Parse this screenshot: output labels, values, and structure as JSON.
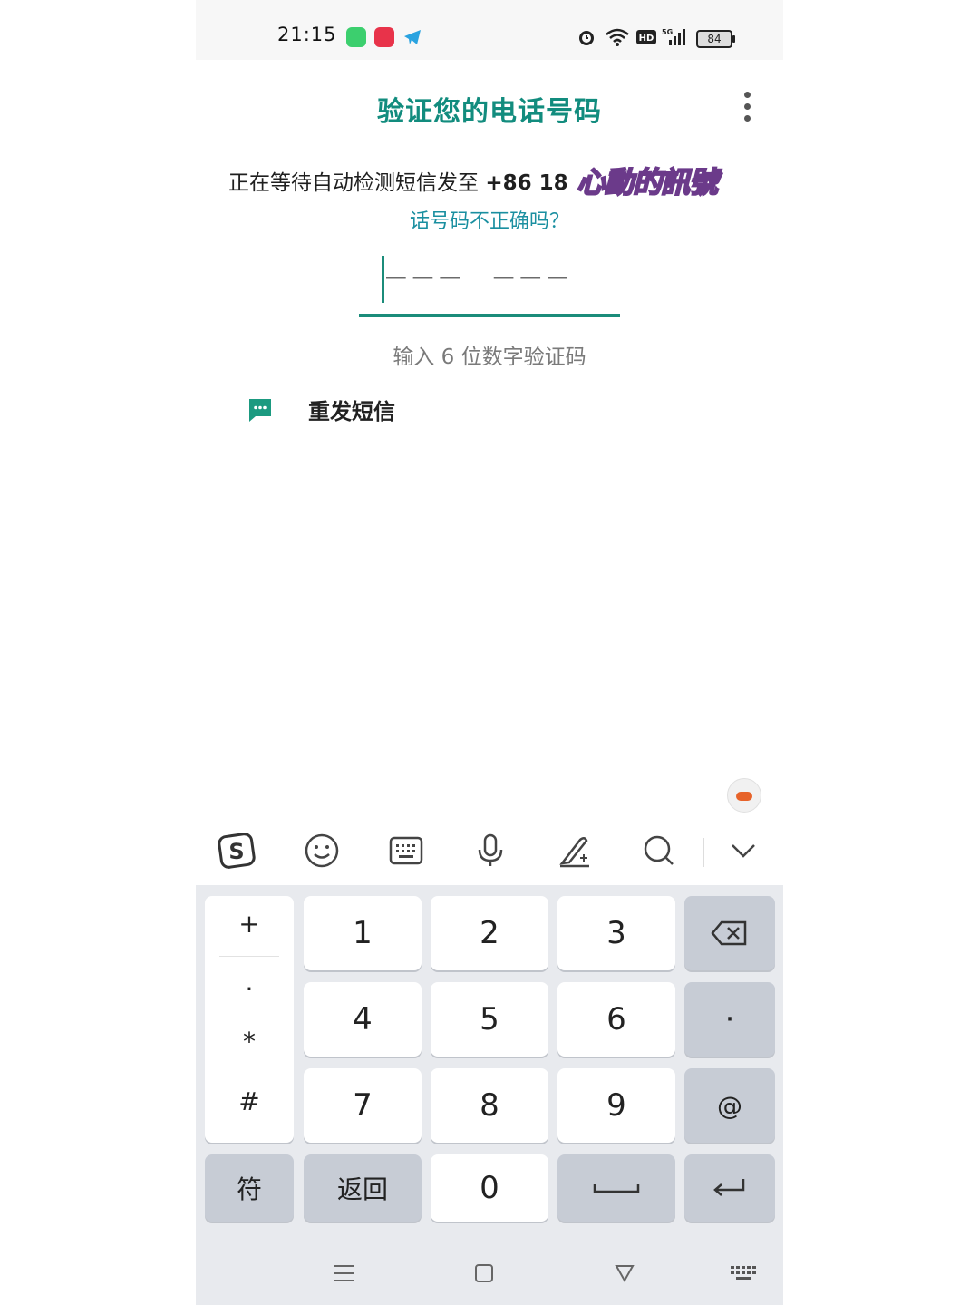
{
  "status_bar": {
    "time": "21:15",
    "apps": [
      "green-app-icon",
      "red-app-icon",
      "telegram-icon"
    ],
    "indicators": [
      "alarm-icon",
      "wifi-icon",
      "hd-icon",
      "5g-signal-icon"
    ],
    "battery": "84"
  },
  "header": {
    "title": "验证您的电话号码",
    "menu_icon": "more-vert-icon"
  },
  "body": {
    "waiting_text": "正在等待自动检测短信发至 ",
    "phone_prefix": "+86 18",
    "overlay_sticker": "心動的訊號",
    "wrong_number_link": "话号码不正确吗？",
    "code_placeholder": "––– –––",
    "code_hint": "输入 6 位数字验证码",
    "resend_label": "重发短信"
  },
  "keyboard": {
    "toolbar": [
      "sogou-logo-icon",
      "emoji-icon",
      "keyboard-icon",
      "microphone-icon",
      "handwriting-icon",
      "search-icon",
      "collapse-chevron-icon"
    ],
    "symbols": [
      "+",
      ".",
      "*",
      "#"
    ],
    "digits": [
      "1",
      "2",
      "3",
      "4",
      "5",
      "6",
      "7",
      "8",
      "9",
      "0"
    ],
    "right_keys": {
      "dot": "·",
      "at": "@"
    },
    "bottom": {
      "symbols_label": "符",
      "back_label": "返回"
    }
  },
  "navbar": [
    "menu-icon",
    "home-square-icon",
    "back-triangle-icon",
    "keyboard-switch-icon"
  ],
  "colors": {
    "accent": "#128c7e",
    "link": "#1a8fa0",
    "keyboard_bg": "#e8eaee",
    "function_key": "#c7ccd5"
  }
}
